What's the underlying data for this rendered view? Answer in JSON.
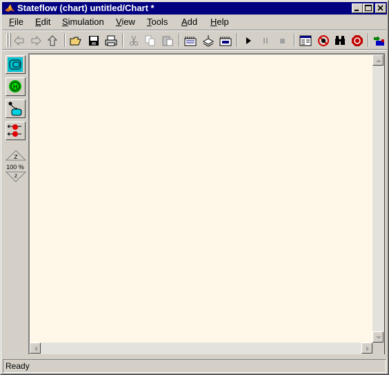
{
  "window": {
    "title": "Stateflow (chart) untitled/Chart *"
  },
  "menu": [
    {
      "label": "File",
      "u": "F",
      "rest": "ile"
    },
    {
      "label": "Edit",
      "u": "E",
      "rest": "dit"
    },
    {
      "label": "Simulation",
      "u": "S",
      "rest": "imulation"
    },
    {
      "label": "View",
      "u": "V",
      "rest": "iew"
    },
    {
      "label": "Tools",
      "u": "T",
      "rest": "ools"
    },
    {
      "label": "Add",
      "u": "A",
      "rest": "dd"
    },
    {
      "label": "Help",
      "u": "H",
      "rest": "elp"
    }
  ],
  "toolbar": {
    "items": [
      "back-icon",
      "forward-icon",
      "up-icon",
      "open-icon",
      "save-icon",
      "print-icon",
      "cut-icon",
      "copy-icon",
      "paste-icon",
      "build-icon",
      "rebuild-icon",
      "target-build-icon",
      "play-icon",
      "pause-icon",
      "stop-icon",
      "explorer-icon",
      "debugger-icon",
      "find-icon",
      "stop-sign-icon",
      "go-to-model-icon"
    ]
  },
  "palette": {
    "tools": [
      "state-tool-icon",
      "history-junction-tool-icon",
      "default-transition-tool-icon",
      "connective-junction-tool-icon"
    ],
    "zoom": "100 %",
    "zoom_in_label": "Z",
    "zoom_out_label": "z"
  },
  "status": {
    "text": "Ready"
  },
  "colors": {
    "titlebar": "#000080",
    "canvas": "#fff8e8",
    "chrome": "#d4d0c8"
  }
}
